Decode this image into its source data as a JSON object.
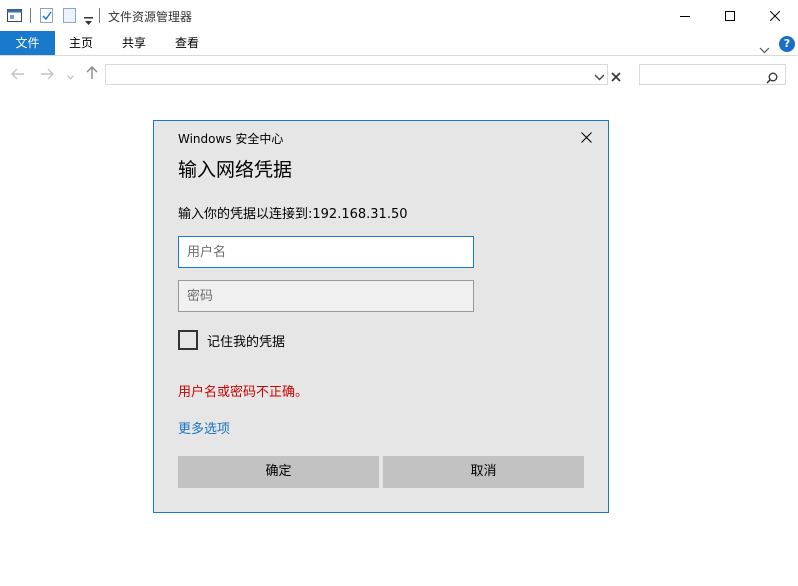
{
  "window": {
    "title": "文件资源管理器"
  },
  "ribbon": {
    "tabs": [
      {
        "label": "文件",
        "active": true
      },
      {
        "label": "主页"
      },
      {
        "label": "共享"
      },
      {
        "label": "查看"
      }
    ],
    "help_label": "?"
  },
  "address": {
    "value": ""
  },
  "search": {
    "placeholder": ""
  },
  "dialog": {
    "app_name": "Windows 安全中心",
    "title": "输入网络凭据",
    "message": "输入你的凭据以连接到:192.168.31.50",
    "username_placeholder": "用户名",
    "password_placeholder": "密码",
    "remember_label": "记住我的凭据",
    "remember_checked": false,
    "error_text": "用户名或密码不正确。",
    "more_options": "更多选项",
    "ok_label": "确定",
    "cancel_label": "取消"
  },
  "colors": {
    "accent": "#1979ca",
    "error": "#c50500",
    "link": "#1a73c0",
    "dialog_bg": "#e6e6e6",
    "button_bg": "#c2c2c2"
  },
  "icons": {
    "quick_access": [
      "properties-icon",
      "checkmark-document-icon",
      "new-folder-icon",
      "customize-dropdown-icon"
    ],
    "window_controls": [
      "minimize-icon",
      "maximize-icon",
      "close-icon"
    ],
    "navigation": [
      "back-arrow-icon",
      "forward-arrow-icon",
      "recent-locations-icon",
      "up-arrow-icon"
    ]
  }
}
